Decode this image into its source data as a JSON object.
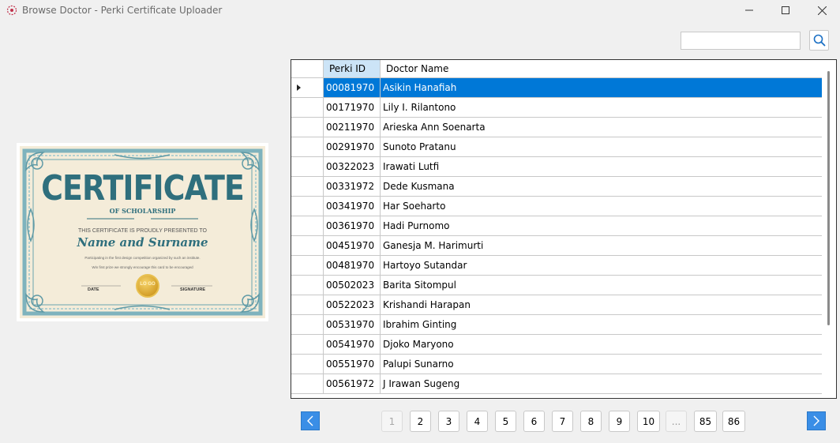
{
  "window": {
    "title": "Browse Doctor - Perki Certificate Uploader",
    "controls": [
      "minimize",
      "maximize",
      "close"
    ]
  },
  "search": {
    "value": "",
    "placeholder": "",
    "button_icon": "search-icon"
  },
  "certificate": {
    "title": "CERTIFICATE",
    "subtitle": "OF SCHOLARSHIP",
    "presented": "THIS CERTIFICATE IS PROUDLY PRESENTED TO",
    "name": "Name and Surname",
    "line1": "Participating in the first design competition organized by such an institute.",
    "line2": "Win first prize we strongly encourage this card to be encouraged",
    "logo_text": "LO GO",
    "date_label": "DATE",
    "signature_label": "SIGNATURE",
    "colors": {
      "primary": "#2f6f7d",
      "background": "#f4ecd9",
      "gold": "#d4a02a"
    }
  },
  "grid": {
    "columns": [
      "Perki ID",
      "Doctor Name"
    ],
    "selected_index": 0,
    "rows": [
      [
        "00081970",
        "Asikin Hanafiah"
      ],
      [
        "00171970",
        "Lily I. Rilantono"
      ],
      [
        "00211970",
        "Arieska Ann Soenarta"
      ],
      [
        "00291970",
        "Sunoto Pratanu"
      ],
      [
        "00322023",
        "Irawati Lutfi"
      ],
      [
        "00331972",
        "Dede Kusmana"
      ],
      [
        "00341970",
        "Har Soeharto"
      ],
      [
        "00361970",
        "Hadi Purnomo"
      ],
      [
        "00451970",
        "Ganesja M. Harimurti"
      ],
      [
        "00481970",
        "Hartoyo Sutandar"
      ],
      [
        "00502023",
        "Barita Sitompul"
      ],
      [
        "00522023",
        "Krishandi Harapan"
      ],
      [
        "00531970",
        "Ibrahim Ginting"
      ],
      [
        "00541970",
        "Djoko Maryono"
      ],
      [
        "00551970",
        "Palupi Sunarno"
      ],
      [
        "00561972",
        "J Irawan Sugeng"
      ]
    ],
    "colors": {
      "selected": "#0078d7",
      "header_active": "#cce4f7"
    }
  },
  "pagination": {
    "prev_icon": "chevron-left-icon",
    "next_icon": "chevron-right-icon",
    "current": "1",
    "pages": [
      "1",
      "2",
      "3",
      "4",
      "5",
      "6",
      "7",
      "8",
      "9",
      "10",
      "...",
      "85",
      "86"
    ],
    "accent": "#3a8ee6"
  }
}
